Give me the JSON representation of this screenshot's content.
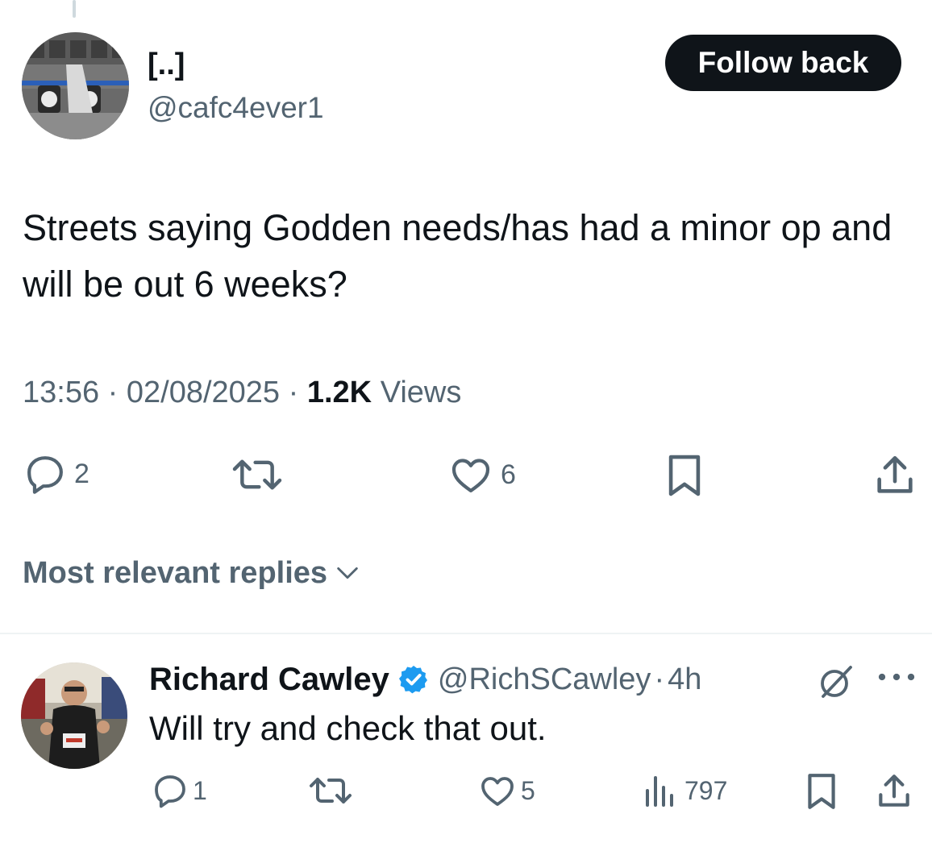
{
  "tweet": {
    "display_name": "[..]",
    "handle": "@cafc4ever1",
    "follow_label": "Follow back",
    "text": "Streets saying Godden needs/has had a minor op and will be out 6 weeks?",
    "time": "13:56",
    "sep1": "·",
    "date": "02/08/2025",
    "sep2": "·",
    "views_count": "1.2K",
    "views_label": "Views",
    "actions": {
      "reply_count": "2",
      "like_count": "6",
      "icons": [
        "reply-icon",
        "retweet-icon",
        "like-icon",
        "bookmark-icon",
        "share-icon"
      ]
    }
  },
  "replies_sort": {
    "label": "Most relevant replies"
  },
  "reply": {
    "display_name": "Richard Cawley",
    "handle": "@RichSCawley",
    "sep": "·",
    "time": "4h",
    "text": "Will try and check that out.",
    "reply_count": "1",
    "like_count": "5",
    "views_count": "797",
    "icons": [
      "reply-icon",
      "retweet-icon",
      "like-icon",
      "views-icon",
      "bookmark-icon",
      "share-icon",
      "grok-icon",
      "more-icon",
      "verified-badge-icon"
    ]
  },
  "colors": {
    "text_primary": "#0f1419",
    "text_secondary": "#536471",
    "button_bg": "#0f1419",
    "verified_blue": "#1d9bf0",
    "divider": "#eff3f4"
  }
}
